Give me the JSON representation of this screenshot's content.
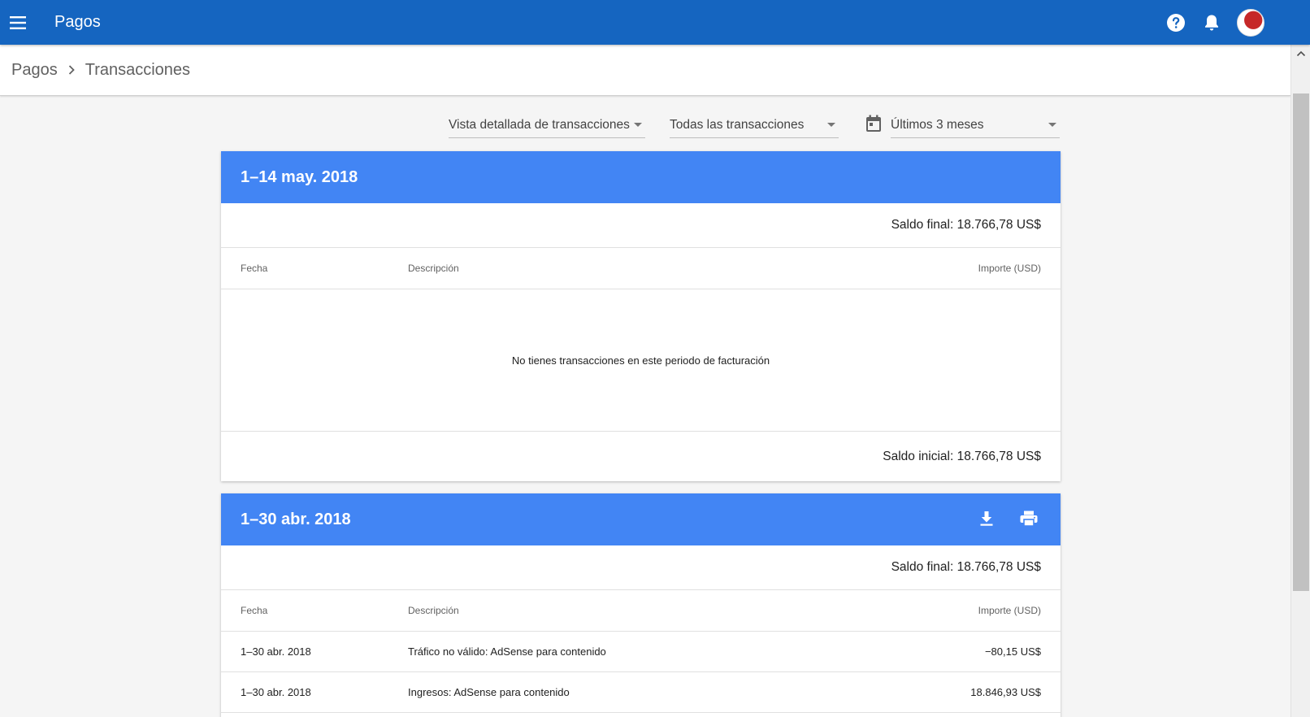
{
  "header": {
    "title": "Pagos"
  },
  "breadcrumb": {
    "parent": "Pagos",
    "current": "Transacciones"
  },
  "filters": {
    "view": "Vista detallada de transacciones",
    "type": "Todas las transacciones",
    "range": "Últimos 3 meses"
  },
  "columns": {
    "date": "Fecha",
    "description": "Descripción",
    "amount": "Importe (USD)"
  },
  "periods": [
    {
      "title": "1–14 may. 2018",
      "closing": "Saldo final: 18.766,78 US$",
      "empty_message": "No tienes transacciones en este periodo de facturación",
      "opening": "Saldo inicial: 18.766,78 US$"
    },
    {
      "title": "1–30 abr. 2018",
      "closing": "Saldo final: 18.766,78 US$",
      "transactions": [
        {
          "date": "1–30 abr. 2018",
          "description": "Tráfico no válido: AdSense para contenido",
          "amount": "−80,15 US$"
        },
        {
          "date": "1–30 abr. 2018",
          "description": "Ingresos: AdSense para contenido",
          "amount": "18.846,93 US$"
        }
      ]
    }
  ],
  "colors": {
    "app_bar": "#1565c0",
    "card_header": "#4285f4",
    "background": "#f5f5f5"
  }
}
